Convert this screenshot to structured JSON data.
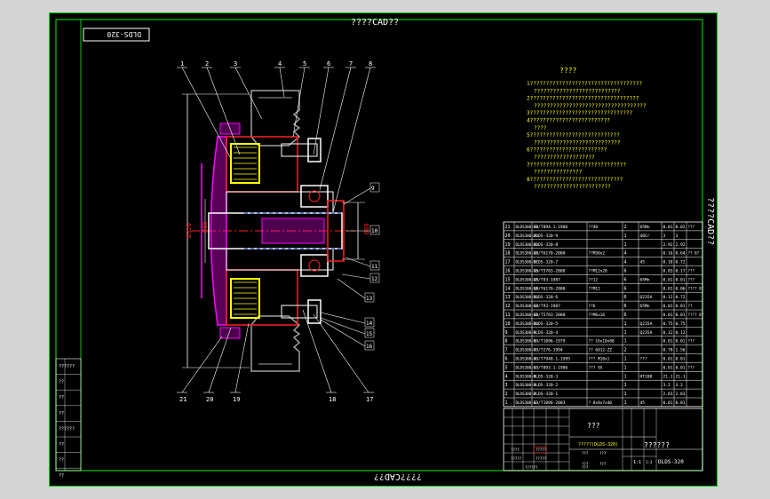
{
  "sheet": {
    "top_title": "????CAD??",
    "bottom_title": "????CAD??",
    "right_title": "????CAD??",
    "drawing_code_box": "DLDS-320"
  },
  "notes": {
    "title": "????",
    "lines": [
      "1???????????????????????????????????",
      "???????????????????????????",
      "2??????????????????????????????????",
      "???????????????????????????????????",
      "3????????????????????????????????",
      "4?????????????????????????",
      "????",
      "5????????????????????????????",
      "???????????????????????????",
      "6????????????????????????",
      "???????????????????",
      "7??????????????????????????????",
      "???????????????",
      "8?????????????????????????????",
      "????????????????????????"
    ]
  },
  "callouts": [
    "1",
    "2",
    "3",
    "4",
    "5",
    "6",
    "7",
    "8",
    "9",
    "10",
    "11",
    "12",
    "13",
    "14",
    "15",
    "16",
    "17",
    "18",
    "19",
    "20",
    "21"
  ],
  "dimensions": {
    "left_vertical": "Ø320",
    "inner_vertical": "Ø80",
    "right_vertical": "Ø60"
  },
  "bom": {
    "rows": [
      {
        "no": "21",
        "code": "DLDS300-21",
        "name": "GB/T894.1-1986",
        "desc": "??40",
        "qty": "2",
        "mat": "65Mn",
        "w1": "0.01",
        "w2": "0.02",
        "note": "???"
      },
      {
        "no": "20",
        "code": "DLDS300-20",
        "name": "DLDS-320-9",
        "desc": "",
        "qty": "1",
        "mat": "40Cr",
        "w1": "3",
        "w2": "3",
        "note": ""
      },
      {
        "no": "19",
        "code": "DLDS300-19",
        "name": "DLDS-320-8",
        "desc": "",
        "qty": "1",
        "mat": "",
        "w1": "2.92",
        "w2": "2.92",
        "note": ""
      },
      {
        "no": "18",
        "code": "DLDS300-18",
        "name": "GB/T6170-2000",
        "desc": "??M30x2",
        "qty": "4",
        "mat": "",
        "w1": "0.16",
        "w2": "0.64",
        "note": "?? 8?"
      },
      {
        "no": "17",
        "code": "DLDS300-17",
        "name": "DLDS-320-7",
        "desc": "",
        "qty": "4",
        "mat": "45",
        "w1": "0.18",
        "w2": "0.72",
        "note": ""
      },
      {
        "no": "16",
        "code": "DLDS300-16",
        "name": "GB/T5783-2000",
        "desc": "??M12x20",
        "qty": "6",
        "mat": "",
        "w1": "0.03",
        "w2": "0.17",
        "note": "???"
      },
      {
        "no": "15",
        "code": "DLDS300-15",
        "name": "GB/T93-1987",
        "desc": "??12",
        "qty": "6",
        "mat": "65Mn",
        "w1": "0.01",
        "w2": "0.01",
        "note": "???"
      },
      {
        "no": "14",
        "code": "DLDS300-14",
        "name": "GB/T6170-2000",
        "desc": "??M12",
        "qty": "6",
        "mat": "",
        "w1": "0.01",
        "w2": "0.06",
        "note": "???? 8?"
      },
      {
        "no": "13",
        "code": "DLDS300-13",
        "name": "DLDS-320-6",
        "desc": "",
        "qty": "6",
        "mat": "Q235A",
        "w1": "0.12",
        "w2": "0.72",
        "note": ""
      },
      {
        "no": "12",
        "code": "DLDS300-12",
        "name": "GB/T93-1987",
        "desc": "??6",
        "qty": "6",
        "mat": "65Mn",
        "w1": "0.01",
        "w2": "0.01",
        "note": "??"
      },
      {
        "no": "11",
        "code": "DLDS300-11",
        "name": "GB/T5783-2000",
        "desc": "??M6x16",
        "qty": "6",
        "mat": "",
        "w1": "0.01",
        "w2": "0.01",
        "note": "???? 8?"
      },
      {
        "no": "10",
        "code": "DLDS300-10",
        "name": "DLDS-320-5",
        "desc": "",
        "qty": "1",
        "mat": "Q235A",
        "w1": "0.75",
        "w2": "0.75",
        "note": ""
      },
      {
        "no": "9",
        "code": "DLDS300-9",
        "name": "DLDS-320-4",
        "desc": "",
        "qty": "1",
        "mat": "Q235A",
        "w1": "0.12",
        "w2": "0.12",
        "note": ""
      },
      {
        "no": "8",
        "code": "DLDS300-8",
        "name": "GB/T1096-1979",
        "desc": "?? 16x10x80",
        "qty": "1",
        "mat": "",
        "w1": "0.01",
        "w2": "0.01",
        "note": "???"
      },
      {
        "no": "7",
        "code": "DLDS300-7",
        "name": "GB/T276-1994",
        "desc": "?? 6012-ZZ",
        "qty": "2",
        "mat": "",
        "w1": "0.78",
        "w2": "1.56",
        "note": ""
      },
      {
        "no": "6",
        "code": "DLDS300-6",
        "name": "JB/T7940.1-1995",
        "desc": "??? M10x1",
        "qty": "1",
        "mat": "???",
        "w1": "0.01",
        "w2": "0.01",
        "note": ""
      },
      {
        "no": "5",
        "code": "DLDS300-5",
        "name": "GB/T893.1-1986",
        "desc": "??? 95",
        "qty": "1",
        "mat": "",
        "w1": "0.01",
        "w2": "0.01",
        "note": "???"
      },
      {
        "no": "4",
        "code": "DLDS300-4",
        "name": "DLDS-320-3",
        "desc": "",
        "qty": "1",
        "mat": "HT200",
        "w1": "21.1",
        "w2": "21.1",
        "note": ""
      },
      {
        "no": "3",
        "code": "DLDS300-3",
        "name": "DLDS-320-2",
        "desc": "",
        "qty": "1",
        "mat": "",
        "w1": "3.2",
        "w2": "3.2",
        "note": ""
      },
      {
        "no": "2",
        "code": "DLDS300-2",
        "name": "DLDS-320-1",
        "desc": "",
        "qty": "1",
        "mat": "",
        "w1": "2.83",
        "w2": "2.83",
        "note": ""
      },
      {
        "no": "1",
        "code": "DLDS300-1",
        "name": "GB/T1096-2003",
        "desc": "? 8x8x7x40",
        "qty": "1",
        "mat": "45",
        "w1": "0.01",
        "w2": "0.01",
        "note": ""
      }
    ]
  },
  "title_block": {
    "assembly_name": "???",
    "designer": "?????(DLDS-320)",
    "company": "??????",
    "drawing_no": "DLDS-320",
    "ratio_label": "1:1",
    "small_values": [
      "1:3",
      "????",
      "?????",
      "?????",
      "?????",
      "???",
      "???",
      "???",
      "???",
      "??????",
      "???"
    ]
  },
  "left_strip": {
    "labels": [
      "??????",
      "??",
      "??",
      "??",
      "??????",
      "??",
      "??",
      "??"
    ]
  },
  "colors": {
    "frame": "#00cc00",
    "line": "#00ff00",
    "yellow": "#ffff00",
    "magenta": "#ff00ff",
    "red": "#ff2020",
    "cyan": "#00ffff",
    "white": "#ffffff",
    "blue": "#3060ff",
    "gray": "#9a9a9a",
    "orange": "#ff8000"
  }
}
